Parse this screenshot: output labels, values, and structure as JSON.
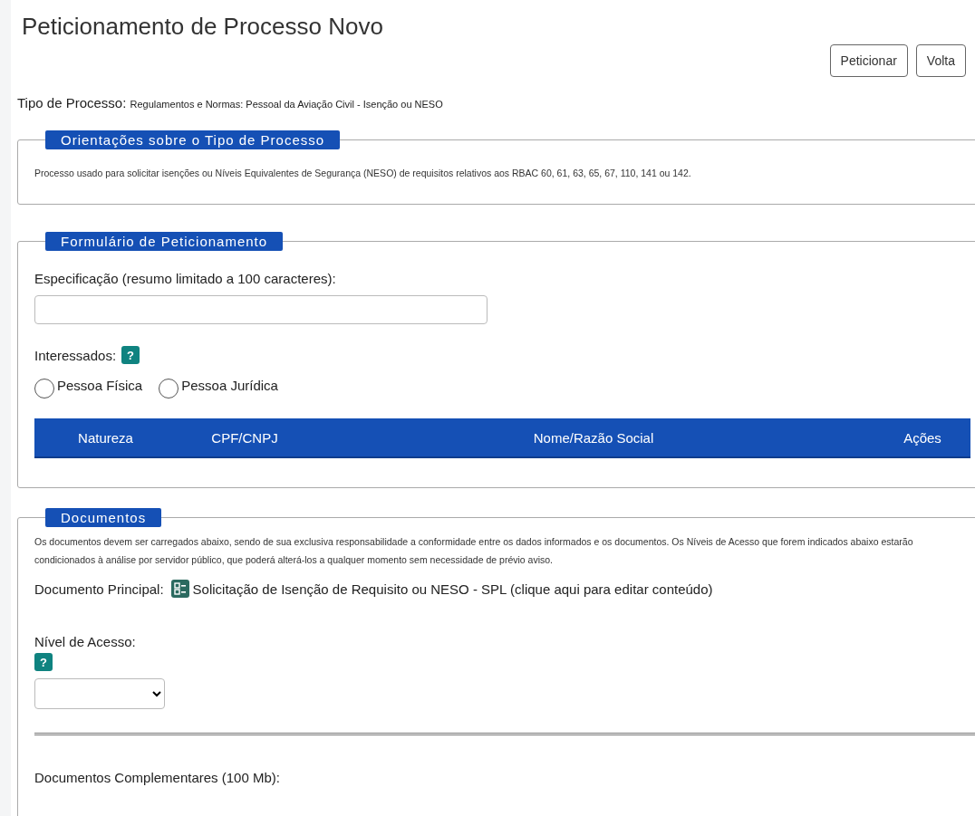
{
  "page_title": "Peticionamento de Processo Novo",
  "buttons": [
    {
      "label": "Peticionar"
    },
    {
      "label": "Volta"
    }
  ],
  "process_type": {
    "label": "Tipo de Processo:",
    "value": "Regulamentos e Normas: Pessoal da Aviação Civil - Isenção ou NESO"
  },
  "guidance": {
    "legend": "Orientações sobre o Tipo de Processo",
    "text": "Processo usado para solicitar isenções ou Níveis Equivalentes de Segurança (NESO) de requisitos relativos aos RBAC 60, 61, 63, 65, 67, 110, 141 ou 142."
  },
  "form": {
    "legend": "Formulário de Peticionamento",
    "specification_label": "Especificação (resumo limitado a 100 caracteres):",
    "interested_label": "Interessados:",
    "help": "?",
    "options": [
      {
        "label": "Pessoa Física",
        "selected": false
      },
      {
        "label": "Pessoa Jurídica",
        "selected": false
      }
    ],
    "table": {
      "columns": [
        "Natureza",
        "CPF/CNPJ",
        "Nome/Razão Social",
        "Ações"
      ]
    }
  },
  "documents": {
    "legend": "Documentos",
    "notice": "Os documentos devem ser carregados abaixo, sendo de sua exclusiva responsabilidade a conformidade entre os dados informados e os documentos. Os Níveis de Acesso que forem indicados abaixo estarão condicionados à análise por servidor público, que poderá alterá-los a qualquer momento sem necessidade de prévio aviso.",
    "main_label": "Documento Principal:",
    "main_link": "Solicitação de Isenção de Requisito ou NESO - SPL (clique aqui para editar conteúdo)",
    "access_label": "Nível de Acesso:",
    "help": "?",
    "complementary_label": "Documentos Complementares (100 Mb):"
  }
}
